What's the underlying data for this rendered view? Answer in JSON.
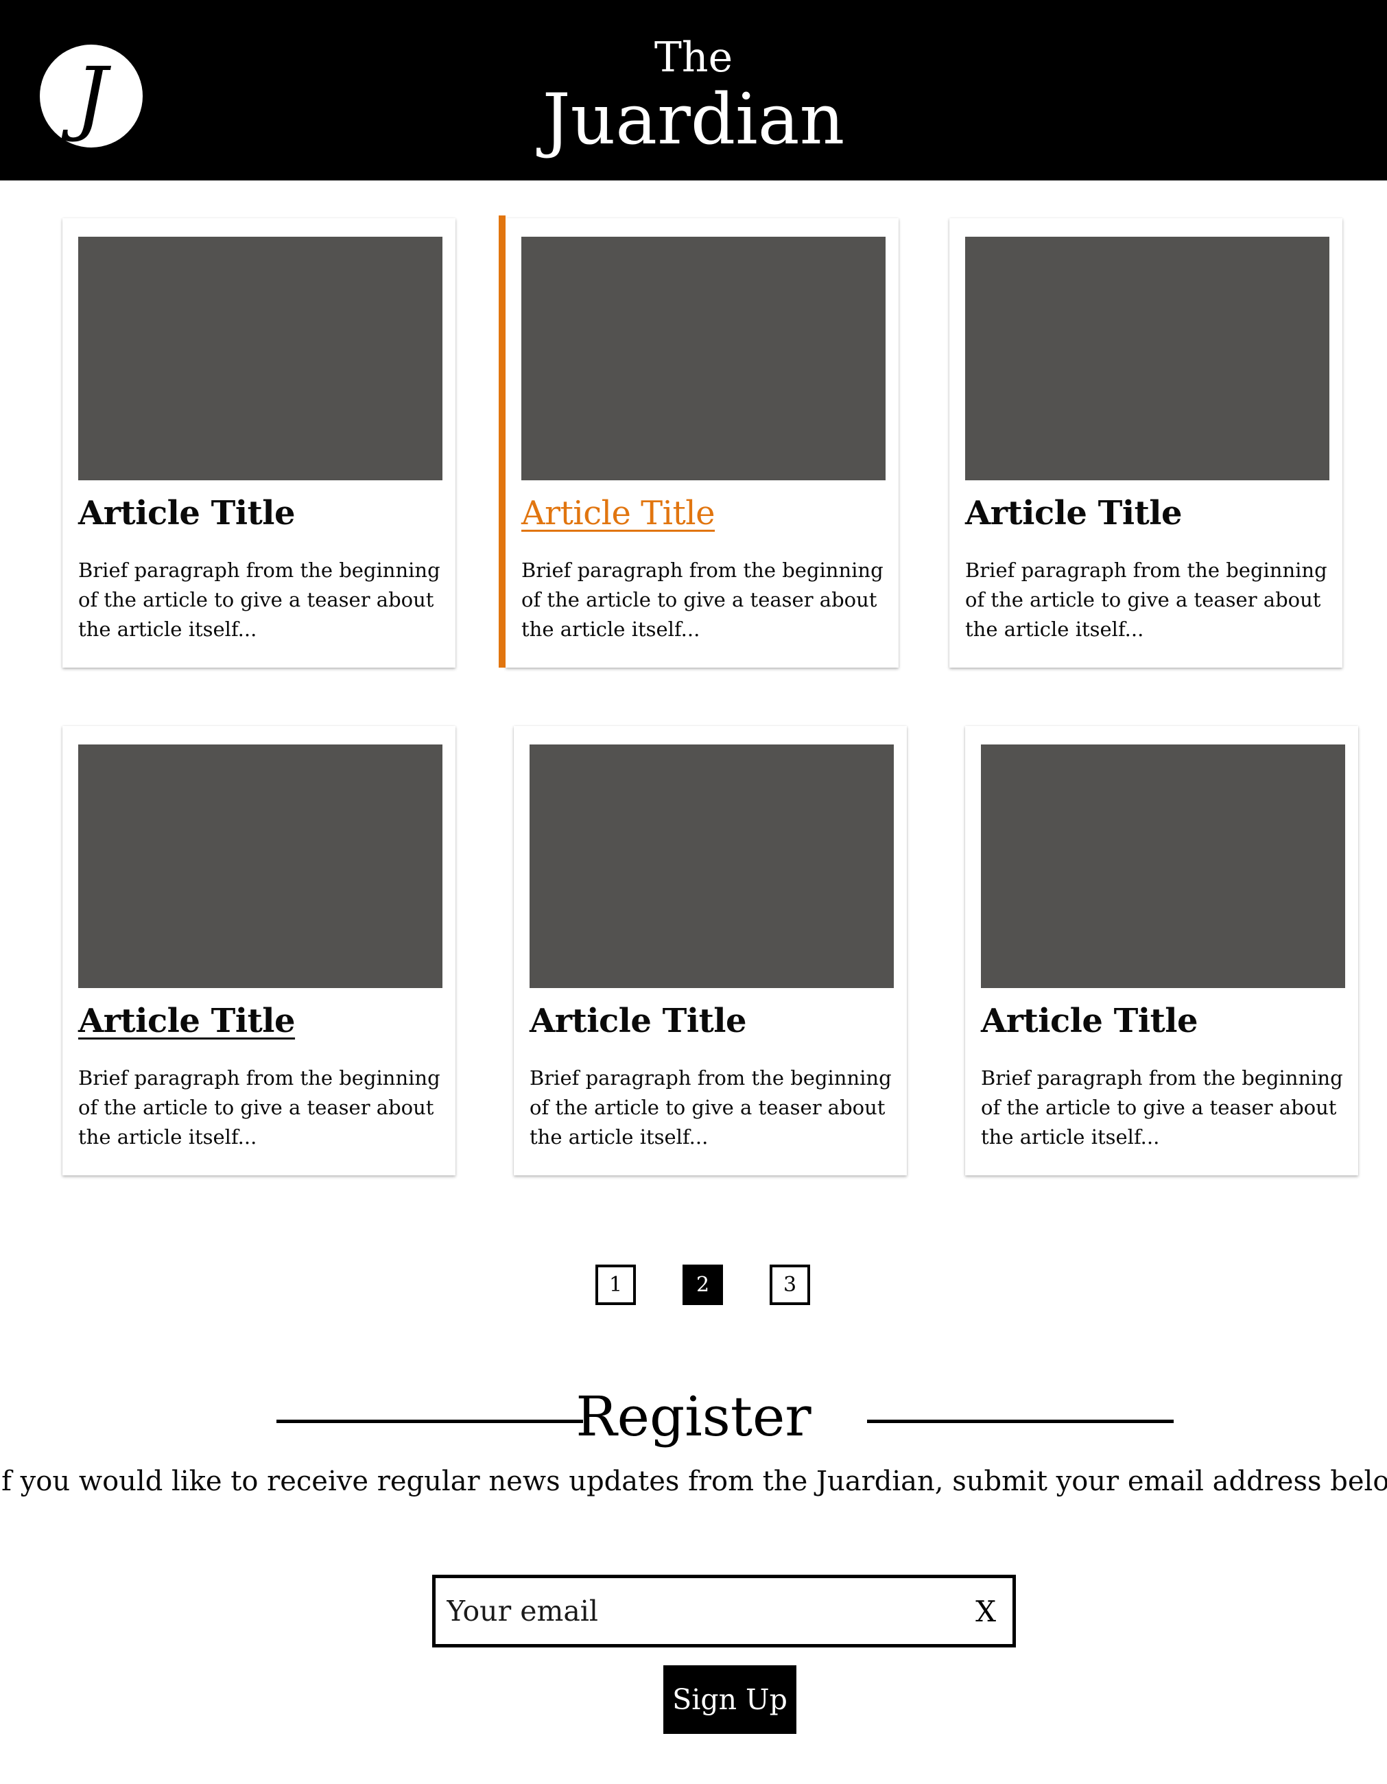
{
  "header": {
    "logo_letter": "J",
    "brand_prefix": "The",
    "brand_name": "Juardian"
  },
  "articles": [
    {
      "title": "Article Title",
      "teaser": "Brief paragraph from the beginning of the article to give a teaser about the article itself..."
    },
    {
      "title": "Article Title",
      "teaser": "Brief paragraph from the beginning of the article to give a teaser about the article itself..."
    },
    {
      "title": "Article Title",
      "teaser": "Brief paragraph from the beginning of the article to give a teaser about the article itself..."
    },
    {
      "title": "Article Title",
      "teaser": "Brief paragraph from the beginning of the article to give a teaser about the article itself..."
    },
    {
      "title": "Article Title",
      "teaser": "Brief paragraph from the beginning of the article to give a teaser about the article itself..."
    },
    {
      "title": "Article Title",
      "teaser": "Brief paragraph from the beginning of the article to give a teaser about the article itself..."
    }
  ],
  "pagination": {
    "pages": [
      "1",
      "2",
      "3"
    ],
    "current": "2"
  },
  "register": {
    "title": "Register",
    "description": "If you would like to receive regular news updates from the Juardian, submit your email address below",
    "email_placeholder": "Your email",
    "clear_label": "X",
    "signup_label": "Sign Up"
  },
  "colors": {
    "accent": "#e1750f",
    "header_bg": "#000000",
    "image_placeholder": "#535250"
  }
}
